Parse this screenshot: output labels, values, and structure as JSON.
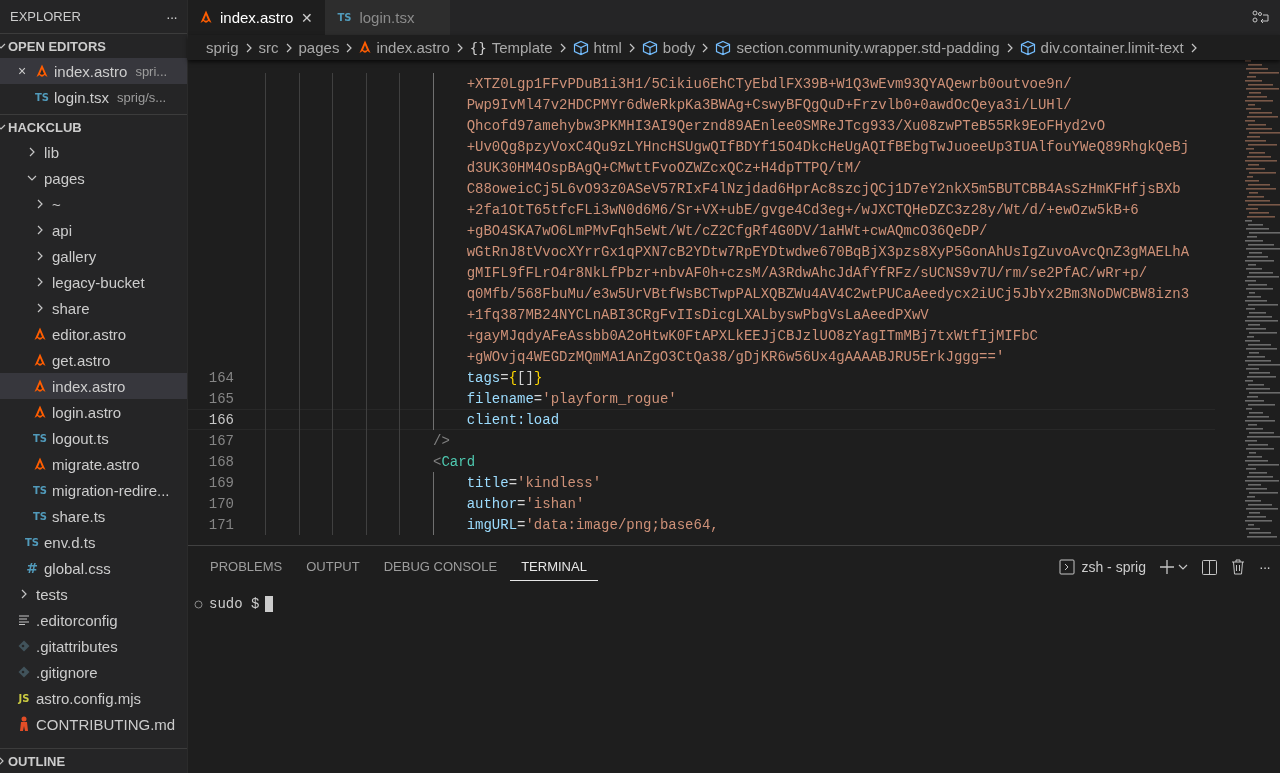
{
  "sidebar": {
    "title": "EXPLORER",
    "more": "···",
    "open_editors": {
      "title": "OPEN EDITORS",
      "expanded": true,
      "items": [
        {
          "name": "index.astro",
          "path": "spri...",
          "kind": "astro",
          "close": "×",
          "selected": true
        },
        {
          "name": "login.tsx",
          "path": "sprig/s...",
          "kind": "ts",
          "icon_label": "TS",
          "selected": false
        }
      ]
    },
    "project": {
      "title": "HACKCLUB",
      "expanded": true,
      "items": [
        {
          "children": [
            {
              "name": "lib",
              "kind": "folder",
              "expanded": false,
              "selected": false
            },
            {
              "name": "pages",
              "kind": "folder",
              "expanded": true,
              "selected": false,
              "children": [
                {
                  "name": "~",
                  "kind": "folder",
                  "expanded": false,
                  "selected": false
                },
                {
                  "name": "api",
                  "kind": "folder",
                  "expanded": false,
                  "selected": false
                },
                {
                  "name": "gallery",
                  "kind": "folder",
                  "expanded": false,
                  "selected": false
                },
                {
                  "name": "legacy-bucket",
                  "kind": "folder",
                  "expanded": false,
                  "selected": false
                },
                {
                  "name": "share",
                  "kind": "folder",
                  "expanded": false,
                  "selected": false
                },
                {
                  "name": "editor.astro",
                  "kind": "astro",
                  "selected": false
                },
                {
                  "name": "get.astro",
                  "kind": "astro",
                  "selected": false
                },
                {
                  "name": "index.astro",
                  "kind": "astro",
                  "selected": true
                },
                {
                  "name": "login.astro",
                  "kind": "astro",
                  "selected": false
                },
                {
                  "name": "logout.ts",
                  "kind": "ts",
                  "icon_label": "TS",
                  "selected": false
                },
                {
                  "name": "migrate.astro",
                  "kind": "astro",
                  "selected": false
                },
                {
                  "name": "migration-redire...",
                  "kind": "ts",
                  "icon_label": "TS",
                  "selected": false
                },
                {
                  "name": "share.ts",
                  "kind": "ts",
                  "icon_label": "TS",
                  "selected": false
                }
              ]
            },
            {
              "name": "env.d.ts",
              "kind": "ts",
              "icon_label": "TS",
              "selected": false
            },
            {
              "name": "global.css",
              "kind": "css",
              "icon_label": "#",
              "selected": false
            }
          ]
        },
        {
          "name": "tests",
          "kind": "folder",
          "expanded": false,
          "selected": false
        },
        {
          "name": ".editorconfig",
          "kind": "config",
          "selected": false
        },
        {
          "name": ".gitattributes",
          "kind": "git",
          "selected": false
        },
        {
          "name": ".gitignore",
          "kind": "git",
          "selected": false
        },
        {
          "name": "astro.config.mjs",
          "kind": "js",
          "icon_label": "JS",
          "selected": false
        },
        {
          "name": "CONTRIBUTING.md",
          "kind": "md",
          "selected": false
        }
      ]
    },
    "outline": {
      "title": "OUTLINE",
      "expanded": false
    }
  },
  "tabs": [
    {
      "label": "index.astro",
      "kind": "astro",
      "close": "✕",
      "selected": true
    },
    {
      "label": "login.tsx",
      "kind": "ts",
      "icon_label": "TS",
      "selected": false
    }
  ],
  "breadcrumbs": [
    {
      "label": "sprig",
      "kind": "folder"
    },
    {
      "label": "src",
      "kind": "folder"
    },
    {
      "label": "pages",
      "kind": "folder"
    },
    {
      "label": "index.astro",
      "kind": "astro"
    },
    {
      "label": "Template",
      "kind": "braces",
      "icon_label": "{}"
    },
    {
      "label": "html",
      "kind": "element"
    },
    {
      "label": "body",
      "kind": "element"
    },
    {
      "label": "section.community.wrapper.std-padding",
      "kind": "element"
    },
    {
      "label": "div.container.limit-text",
      "kind": "element"
    }
  ],
  "code_lines": [
    {
      "kind": "wrap",
      "current": false,
      "tokens": [
        {
          "kind": "string",
          "text": "+XTZ0Lgp1FFvPDuB1i3H1/5Cikiu6EhCTyEbdlFX39B+W1Q3wEvm93QYAQewrb0outvoe9n/"
        }
      ]
    },
    {
      "kind": "wrap",
      "current": false,
      "tokens": [
        {
          "kind": "string",
          "text": "Pwp9IvMl47v2HDCPMYr6dWeRkpKa3BWAg+CswyBFQgQuD+Frzvlb0+0awdOcQeya3i/LUHl/"
        }
      ]
    },
    {
      "kind": "wrap",
      "current": false,
      "tokens": [
        {
          "kind": "string",
          "text": "Qhcofd97amehybw3PKMHI3AI9Qerznd89AEnlee0SMReJTcg933/Xu08zwPTeB55Rk9EoFHyd2vO"
        }
      ]
    },
    {
      "kind": "wrap",
      "current": false,
      "tokens": [
        {
          "kind": "string",
          "text": "+Uv0Qg8pzyVoxC4Qu9zLYHncHSUgwQIfBDYf15O4DkcHeUgAQIfBEbgTwJuoeeUp3IUAlfouYWeQ89RhgkQeBj"
        }
      ]
    },
    {
      "kind": "wrap",
      "current": false,
      "tokens": [
        {
          "kind": "string",
          "text": "d3UK30HM4OspBAgQ+CMwttFvoOZWZcxQCz+H4dpTTPQ/tM/"
        }
      ]
    },
    {
      "kind": "wrap",
      "current": false,
      "tokens": [
        {
          "kind": "string",
          "text": "C88oweicCj5L6vO93z0ASeV57RIxF4lNzjdad6HprAc8szcjQCj1D7eY2nkX5m5BUTCBB4AsSzHmKFHfjsBXb"
        }
      ]
    },
    {
      "kind": "wrap",
      "current": false,
      "tokens": [
        {
          "kind": "string",
          "text": "+2fa1OtT65tfcFLi3wN0d6M6/Sr+VX+ubE/gvge4Cd3eg+/wJXCTQHeDZC3z28y/Wt/d/+ewOzw5kB+6"
        }
      ]
    },
    {
      "kind": "wrap",
      "current": false,
      "tokens": [
        {
          "kind": "string",
          "text": "+gBO4SKA7wO6LmPMvFqh5eWt/Wt/cZ2CfgRf4G0DV/1aHWt+cwAQmcO36QeDP/"
        }
      ]
    },
    {
      "kind": "wrap",
      "current": false,
      "tokens": [
        {
          "kind": "string",
          "text": "wGtRnJ8tVvocXYrrGx1qPXN7cB2YDtw7RpEYDtwdwe670BqBjX3pzs8XyP5GonAhUsIgZuvoAvcQnZ3gMAELhA"
        }
      ]
    },
    {
      "kind": "wrap",
      "current": false,
      "tokens": [
        {
          "kind": "string",
          "text": "gMIFL9fFLrO4r8NkLfPbzr+nbvAF0h+czsM/A3RdwAhcJdAfYfRFz/sUCNS9v7U/rm/se2PfAC/wRr+p/"
        }
      ]
    },
    {
      "kind": "wrap",
      "current": false,
      "tokens": [
        {
          "kind": "string",
          "text": "q0Mfb/568FbuMu/e3w5UrVBtfWsBCTwpPALXQBZWu4AV4C2wtPUCaAeedycx2iUCj5JbYx2Bm3NoDWCBW8izn3"
        }
      ]
    },
    {
      "kind": "wrap",
      "current": false,
      "tokens": [
        {
          "kind": "string",
          "text": "+1fq387MB24NYCLnABI3CRgFvIIsDicgLXALbyswPbgVsLaAeedPXwV"
        }
      ]
    },
    {
      "kind": "wrap",
      "current": false,
      "tokens": [
        {
          "kind": "string",
          "text": "+gayMJqdyAFeAssbb0A2oHtwK0FtAPXLkEEJjCBJzlUO8zYagITmMBj7txWtfIjMIFbC"
        }
      ]
    },
    {
      "kind": "wrap",
      "current": false,
      "tokens": [
        {
          "kind": "string",
          "text": "+gWOvjq4WEGDzMQmMA1AnZgO3CtQa38/gDjKR6w56Ux4gAAAABJRU5ErkJggg=='"
        }
      ]
    },
    {
      "number": "164",
      "kind": "attribute",
      "current": false,
      "tokens": [
        {
          "kind": "attr",
          "text": "tags"
        },
        {
          "kind": "plain",
          "text": "="
        },
        {
          "kind": "brace",
          "text": "{"
        },
        {
          "kind": "plain",
          "text": "[]"
        },
        {
          "kind": "brace",
          "text": "}"
        }
      ]
    },
    {
      "number": "165",
      "kind": "attribute",
      "current": false,
      "tokens": [
        {
          "kind": "attr",
          "text": "filename"
        },
        {
          "kind": "plain",
          "text": "="
        },
        {
          "kind": "string",
          "text": "'playform_rogue'"
        }
      ]
    },
    {
      "number": "166",
      "kind": "attribute",
      "current": true,
      "tokens": [
        {
          "kind": "attr",
          "text": "client:load"
        }
      ]
    },
    {
      "number": "167",
      "kind": "tag",
      "current": false,
      "tokens": [
        {
          "kind": "punct",
          "text": "/>"
        }
      ]
    },
    {
      "number": "168",
      "kind": "tag",
      "current": false,
      "tokens": [
        {
          "kind": "punct",
          "text": "<"
        },
        {
          "kind": "tag",
          "text": "Card"
        }
      ]
    },
    {
      "number": "169",
      "kind": "attribute",
      "current": false,
      "tokens": [
        {
          "kind": "attr",
          "text": "title"
        },
        {
          "kind": "plain",
          "text": "="
        },
        {
          "kind": "string",
          "text": "'kindless'"
        }
      ]
    },
    {
      "number": "170",
      "kind": "attribute",
      "current": false,
      "tokens": [
        {
          "kind": "attr",
          "text": "author"
        },
        {
          "kind": "plain",
          "text": "="
        },
        {
          "kind": "string",
          "text": "'ishan'"
        }
      ]
    },
    {
      "number": "171",
      "kind": "attribute",
      "current": false,
      "tokens": [
        {
          "kind": "attr",
          "text": "imgURL"
        },
        {
          "kind": "plain",
          "text": "="
        },
        {
          "kind": "string",
          "text": "'data:image/png;base64,"
        }
      ]
    }
  ],
  "panel": {
    "tabs": [
      {
        "label": "PROBLEMS",
        "selected": false
      },
      {
        "label": "OUTPUT",
        "selected": false
      },
      {
        "label": "DEBUG CONSOLE",
        "selected": false
      },
      {
        "label": "TERMINAL",
        "selected": true
      }
    ],
    "terminal_name": "zsh - sprig",
    "more": "···",
    "prompt": "sudo $"
  }
}
